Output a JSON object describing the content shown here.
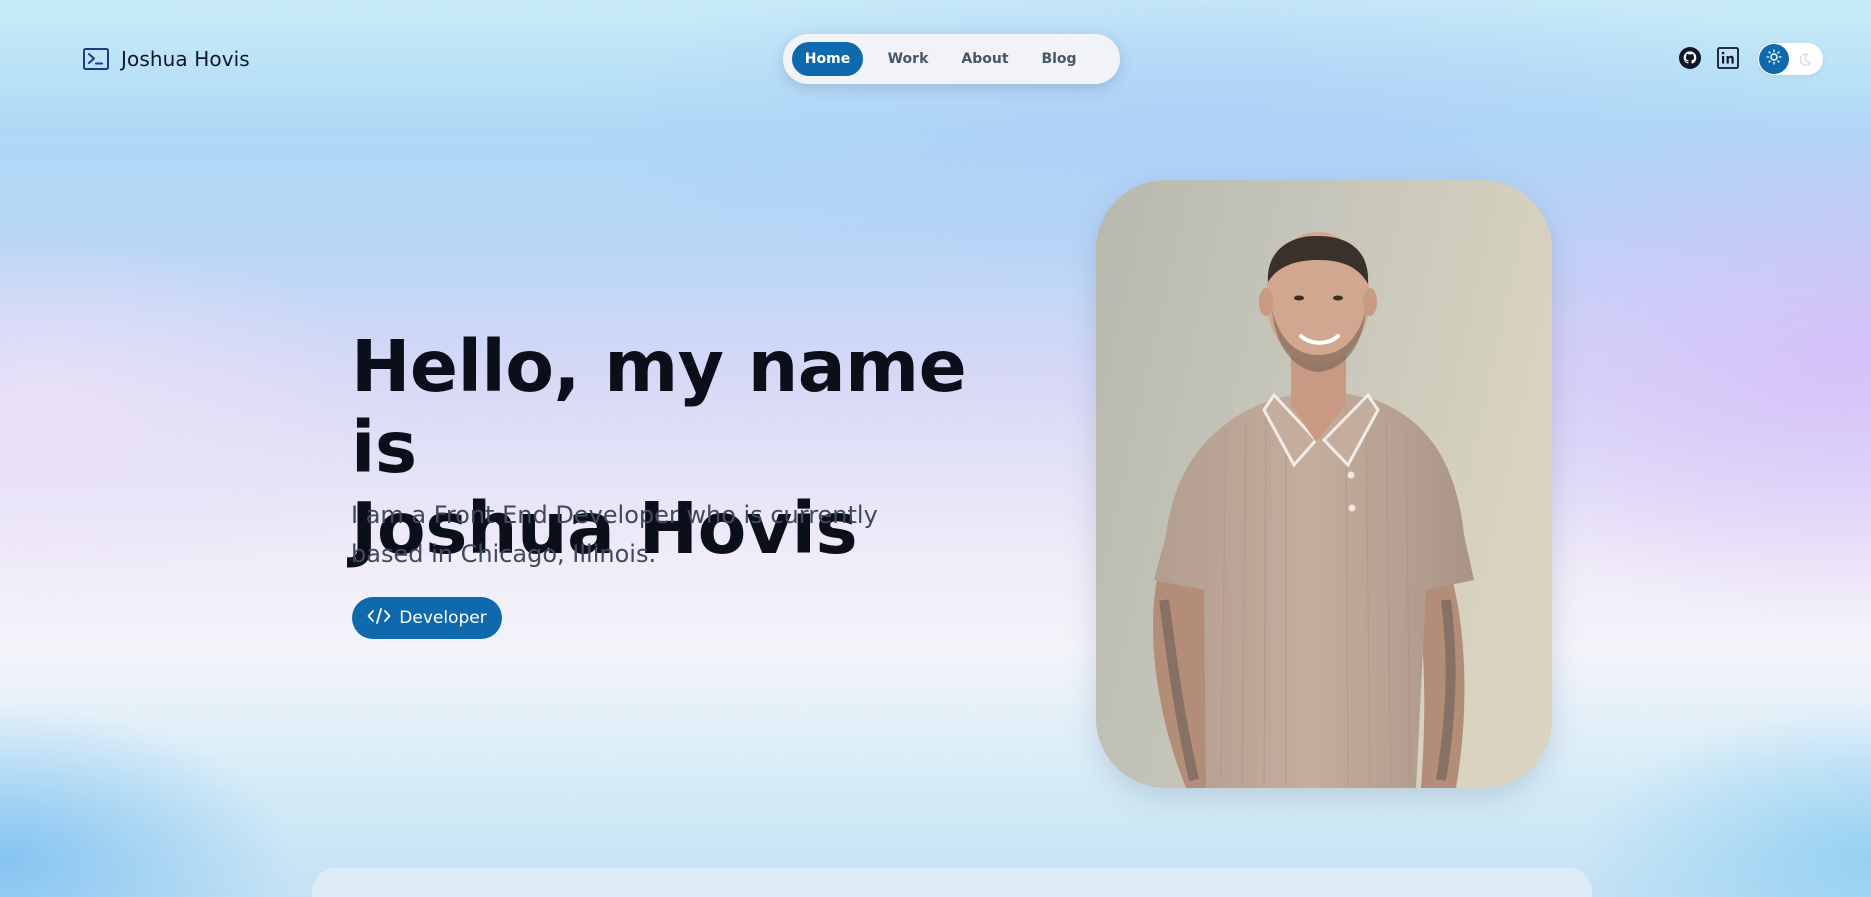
{
  "header": {
    "brand_name": "Joshua Hovis",
    "brand_icon": "terminal-icon",
    "nav": [
      {
        "label": "Home",
        "active": true
      },
      {
        "label": "Work",
        "active": false
      },
      {
        "label": "About",
        "active": false
      },
      {
        "label": "Blog",
        "active": false
      }
    ],
    "social": [
      {
        "icon": "github-icon"
      },
      {
        "icon": "linkedin-icon"
      }
    ],
    "theme_toggle": {
      "mode": "light",
      "icons": [
        "sun-icon",
        "moon-icon"
      ]
    }
  },
  "hero": {
    "title_line1": "Hello, my name is",
    "title_line2": "Joshua Hovis",
    "subtitle_line1": "I am a Front End Developer who is currently",
    "subtitle_line2": "based in Chicago, Illinois.",
    "role_button": {
      "label": "Developer",
      "icon": "code-icon"
    }
  },
  "colors": {
    "accent": "#0f69ad",
    "title_text": "#0b0f19",
    "subtitle_text": "#3f4a5e"
  }
}
